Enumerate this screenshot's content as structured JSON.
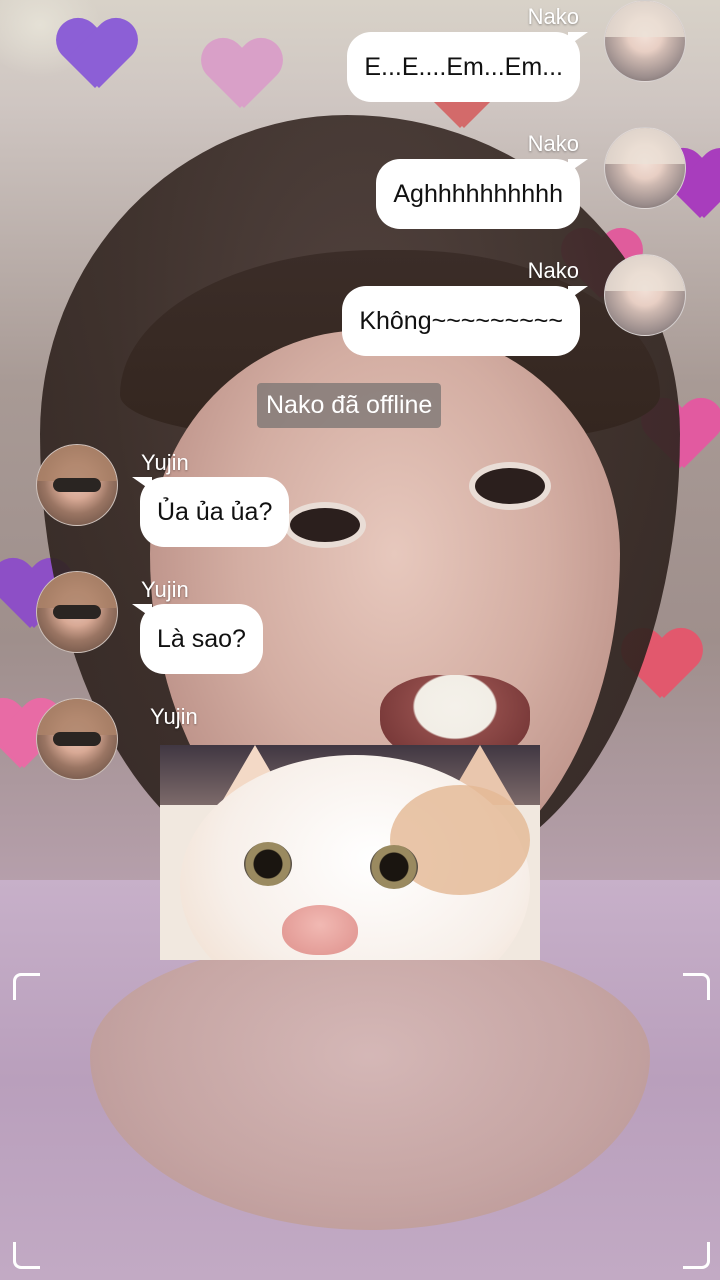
{
  "messages": [
    {
      "side": "right",
      "sender": "Nako",
      "text": "E...E....Em...Em..."
    },
    {
      "side": "right",
      "sender": "Nako",
      "text": "Aghhhhhhhhhh"
    },
    {
      "side": "right",
      "sender": "Nako",
      "text": "Không~~~~~~~~~"
    },
    {
      "side": "left",
      "sender": "Yujin",
      "text": "Ủa ủa ủa?"
    },
    {
      "side": "left",
      "sender": "Yujin",
      "text": "Là sao?"
    },
    {
      "side": "left",
      "sender": "Yujin",
      "image": "surprised-cat-photo"
    }
  ],
  "system_notice": "Nako đã offline",
  "colors": {
    "bubble": "#ffffff",
    "bubble_text": "#111111",
    "sender_text": "#ffffff",
    "system_bg": "#807976"
  }
}
